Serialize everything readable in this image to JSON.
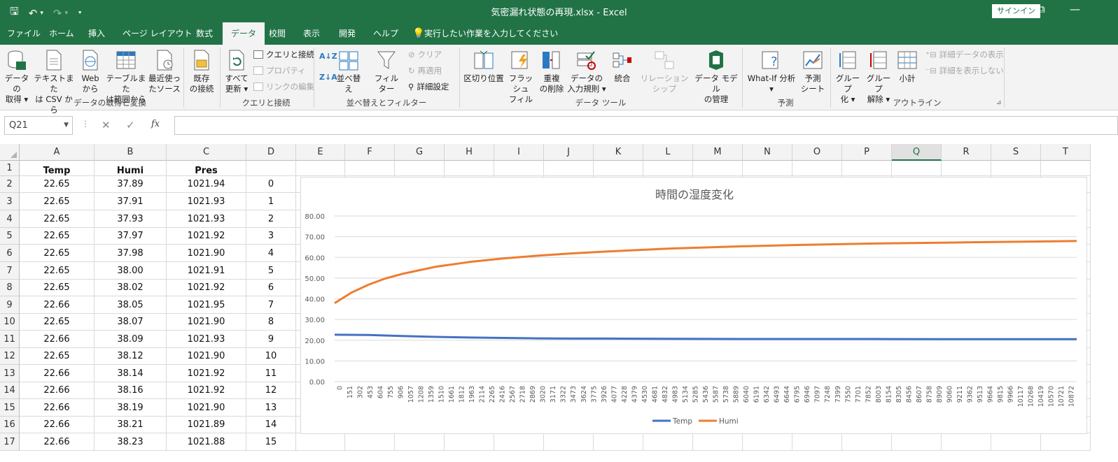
{
  "window": {
    "title": "気密漏れ状態の再現.xlsx  -  Excel",
    "signin": "サインイン",
    "qat": {
      "save": "🖫",
      "undo": "↶",
      "undo_dd": "▾",
      "redo": "↷",
      "redo_dd": "▾",
      "customize": "⯆"
    },
    "controls": {
      "restore": "⧉",
      "minimize": "—"
    }
  },
  "tabs": [
    "ファイル",
    "ホーム",
    "挿入",
    "ページ レイアウト",
    "数式",
    "データ",
    "校閲",
    "表示",
    "開発",
    "ヘルプ"
  ],
  "active_tab": "データ",
  "tellme": "実行したい作業を入力してください",
  "ribbon": {
    "get_data": {
      "l1": "データの",
      "l2": "取得 ▾"
    },
    "text_csv": {
      "l1": "テキストまた",
      "l2": "は CSV から"
    },
    "web": {
      "l1": "Web",
      "l2": "から"
    },
    "table_range": {
      "l1": "テーブルまた",
      "l2": "は範囲から"
    },
    "recent": {
      "l1": "最近使っ",
      "l2": "たソース"
    },
    "existing": {
      "l1": "既存",
      "l2": "の接続"
    },
    "refresh_all": {
      "l1": "すべて",
      "l2": "更新 ▾"
    },
    "queries": "クエリと接続",
    "properties": "プロパティ",
    "edit_links": "リンクの編集",
    "sort": "並べ替え",
    "filter": "フィルター",
    "clear": "クリア",
    "reapply": "再適用",
    "advanced": "詳細設定",
    "text_to_cols": "区切り位置",
    "flash_fill": {
      "l1": "フラッシュ",
      "l2": "フィル"
    },
    "remove_dup": {
      "l1": "重複",
      "l2": "の削除"
    },
    "validation": {
      "l1": "データの",
      "l2": "入力規則 ▾"
    },
    "consolidate": "統合",
    "relationships": "リレーションシップ",
    "data_model": {
      "l1": "データ モデル",
      "l2": "の管理"
    },
    "whatif": {
      "l1": "What-If 分析",
      "l2": "▾"
    },
    "forecast": {
      "l1": "予測",
      "l2": "シート"
    },
    "group": {
      "l1": "グループ",
      "l2": "化 ▾"
    },
    "ungroup": {
      "l1": "グループ",
      "l2": "解除 ▾"
    },
    "subtotal": "小計",
    "show_detail": "詳細データの表示",
    "hide_detail": "詳細を表示しない",
    "groups": {
      "get_transform": "データの取得と変換",
      "queries_conn": "クエリと接続",
      "sort_filter": "並べ替えとフィルター",
      "data_tools": "データ ツール",
      "forecast": "予測",
      "outline": "アウトライン"
    }
  },
  "formula_bar": {
    "name_box": "Q21",
    "formula": "",
    "fx": "fx"
  },
  "columns": [
    "A",
    "B",
    "C",
    "D",
    "E",
    "F",
    "G",
    "H",
    "I",
    "J",
    "K",
    "L",
    "M",
    "N",
    "O",
    "P",
    "Q",
    "R",
    "S",
    "T"
  ],
  "selected_column": "Q",
  "rows": [
    {
      "n": "1",
      "a": "Temp",
      "b": "Humi",
      "c": "Pres",
      "d": ""
    },
    {
      "n": "2",
      "a": "22.65",
      "b": "37.89",
      "c": "1021.94",
      "d": "0"
    },
    {
      "n": "3",
      "a": "22.65",
      "b": "37.91",
      "c": "1021.93",
      "d": "1"
    },
    {
      "n": "4",
      "a": "22.65",
      "b": "37.93",
      "c": "1021.93",
      "d": "2"
    },
    {
      "n": "5",
      "a": "22.65",
      "b": "37.97",
      "c": "1021.92",
      "d": "3"
    },
    {
      "n": "6",
      "a": "22.65",
      "b": "37.98",
      "c": "1021.90",
      "d": "4"
    },
    {
      "n": "7",
      "a": "22.65",
      "b": "38.00",
      "c": "1021.91",
      "d": "5"
    },
    {
      "n": "8",
      "a": "22.65",
      "b": "38.02",
      "c": "1021.92",
      "d": "6"
    },
    {
      "n": "9",
      "a": "22.66",
      "b": "38.05",
      "c": "1021.95",
      "d": "7"
    },
    {
      "n": "10",
      "a": "22.65",
      "b": "38.07",
      "c": "1021.90",
      "d": "8"
    },
    {
      "n": "11",
      "a": "22.66",
      "b": "38.09",
      "c": "1021.93",
      "d": "9"
    },
    {
      "n": "12",
      "a": "22.65",
      "b": "38.12",
      "c": "1021.90",
      "d": "10"
    },
    {
      "n": "13",
      "a": "22.66",
      "b": "38.14",
      "c": "1021.92",
      "d": "11"
    },
    {
      "n": "14",
      "a": "22.66",
      "b": "38.16",
      "c": "1021.92",
      "d": "12"
    },
    {
      "n": "15",
      "a": "22.66",
      "b": "38.19",
      "c": "1021.90",
      "d": "13"
    },
    {
      "n": "16",
      "a": "22.66",
      "b": "38.21",
      "c": "1021.89",
      "d": "14"
    },
    {
      "n": "17",
      "a": "22.66",
      "b": "38.23",
      "c": "1021.88",
      "d": "15"
    }
  ],
  "colors": {
    "brand": "#217346",
    "temp": "#4472C4",
    "humi": "#ED7D31"
  },
  "chart_data": {
    "type": "line",
    "title": "時間の湿度変化",
    "ylim": [
      0,
      80
    ],
    "yticks": [
      "0.00",
      "10.00",
      "20.00",
      "30.00",
      "40.00",
      "50.00",
      "60.00",
      "70.00",
      "80.00"
    ],
    "xticks": [
      "0",
      "151",
      "302",
      "453",
      "604",
      "755",
      "906",
      "1057",
      "1208",
      "1359",
      "1510",
      "1661",
      "1812",
      "1963",
      "2114",
      "2265",
      "2416",
      "2567",
      "2718",
      "2869",
      "3020",
      "3171",
      "3322",
      "3473",
      "3624",
      "3775",
      "3926",
      "4077",
      "4228",
      "4379",
      "4530",
      "4681",
      "4832",
      "4983",
      "5134",
      "5285",
      "5436",
      "5587",
      "5738",
      "5889",
      "6040",
      "6191",
      "6342",
      "6493",
      "6644",
      "6795",
      "6946",
      "7097",
      "7248",
      "7399",
      "7550",
      "7701",
      "7852",
      "8003",
      "8154",
      "8305",
      "8456",
      "8607",
      "8758",
      "8909",
      "9060",
      "9211",
      "9362",
      "9513",
      "9664",
      "9815",
      "9966",
      "10117",
      "10268",
      "10419",
      "10570",
      "10721",
      "10872"
    ],
    "series": [
      {
        "name": "Temp",
        "color": "#4472C4",
        "x": [
          0,
          500,
          1000,
          1500,
          2000,
          2500,
          3000,
          3500,
          4000,
          5000,
          6000,
          7000,
          8000,
          9000,
          10000,
          11000
        ],
        "y": [
          22.65,
          22.5,
          22.0,
          21.6,
          21.3,
          21.1,
          20.9,
          20.8,
          20.8,
          20.7,
          20.6,
          20.6,
          20.6,
          20.5,
          20.5,
          20.5
        ]
      },
      {
        "name": "Humi",
        "color": "#ED7D31",
        "x": [
          0,
          250,
          500,
          750,
          1000,
          1500,
          2000,
          2500,
          3000,
          3500,
          4000,
          5000,
          6000,
          7000,
          8000,
          9000,
          10000,
          11000
        ],
        "y": [
          37.9,
          43.0,
          46.8,
          49.8,
          52.0,
          55.5,
          57.8,
          59.5,
          60.8,
          61.9,
          62.8,
          64.3,
          65.3,
          66.1,
          66.7,
          67.1,
          67.5,
          67.9
        ]
      }
    ],
    "legend": "bottom",
    "grid": true
  }
}
